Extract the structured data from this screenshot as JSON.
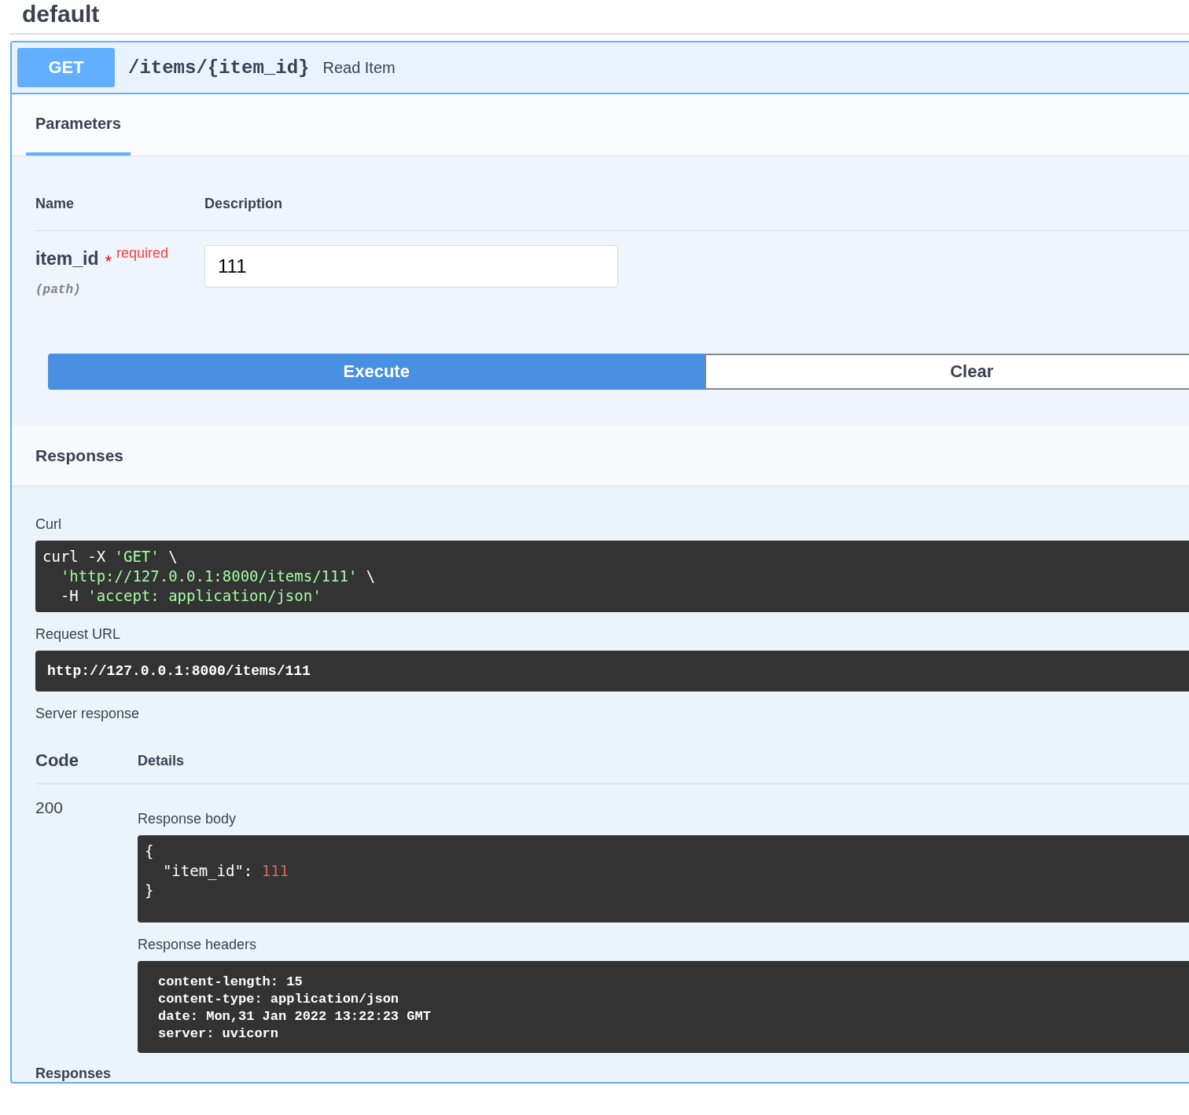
{
  "section_title": "default",
  "operation": {
    "method": "GET",
    "path": "/items/{item_id}",
    "summary": "Read Item"
  },
  "tabs": [
    {
      "label": "Parameters",
      "selected": true
    }
  ],
  "parameters": {
    "columns": [
      "Name",
      "Description"
    ],
    "rows": [
      {
        "name": "item_id",
        "required_mark": "*",
        "required_label": "required",
        "location": "(path)",
        "value": "111"
      }
    ]
  },
  "buttons": [
    {
      "label": "Execute",
      "kind": "primary"
    },
    {
      "label": "Clear",
      "kind": "secondary"
    }
  ],
  "responses_title": "Responses",
  "curl": {
    "label": "Curl",
    "lines": [
      [
        {
          "text": "curl -X ",
          "kind": "plain"
        },
        {
          "text": "'GET'",
          "kind": "string"
        },
        {
          "text": " \\",
          "kind": "plain"
        }
      ],
      [
        {
          "text": "  'http://127.0.0.1:8000/items/111'",
          "kind": "string"
        },
        {
          "text": " \\",
          "kind": "plain"
        }
      ],
      [
        {
          "text": "  -H ",
          "kind": "plain"
        },
        {
          "text": "'accept: application/json'",
          "kind": "string"
        }
      ]
    ]
  },
  "request_url": {
    "label": "Request URL",
    "value": "http://127.0.0.1:8000/items/111"
  },
  "server_response": {
    "label": "Server response",
    "columns": [
      "Code",
      "Details"
    ],
    "code": "200",
    "body_label": "Response body",
    "body_lines": [
      [
        {
          "text": "{",
          "kind": "plain"
        }
      ],
      [
        {
          "text": "  \"item_id\": ",
          "kind": "plain"
        },
        {
          "text": "111",
          "kind": "number"
        }
      ],
      [
        {
          "text": "}",
          "kind": "plain"
        }
      ]
    ],
    "headers_label": "Response headers",
    "headers": [
      "content-length: 15",
      "content-type: application/json",
      "date: Mon,31 Jan 2022 13:22:23 GMT",
      "server: uvicorn"
    ]
  },
  "footer_title": "Responses"
}
